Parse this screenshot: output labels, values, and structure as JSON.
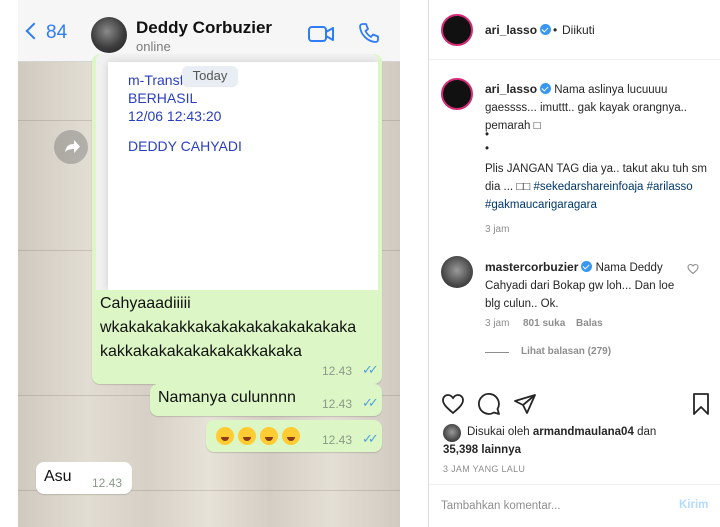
{
  "whatsapp": {
    "back_count": "84",
    "contact_name": "Deddy Corbuzier",
    "contact_status": "online",
    "date_pill": "Today",
    "receipt": {
      "line1": "m-Transfer",
      "line2": "BERHASIL",
      "line3": "12/06 12:43:20",
      "line4": "DEDDY CAHYADI"
    },
    "messages": [
      {
        "text_lines": [
          "Cahyaaadiiiii",
          "wkakakakakkakakakakakakakakaka",
          "kakkakakakakakakakkakaka"
        ],
        "time": "12.43",
        "direction": "out"
      },
      {
        "text": "Namanya culunnnn",
        "time": "12.43",
        "direction": "out"
      },
      {
        "text": "emoji",
        "time": "12.43",
        "direction": "out"
      },
      {
        "text": "Asu",
        "time": "12.43",
        "direction": "in"
      }
    ],
    "icons": {
      "video": "video-camera-icon",
      "phone": "phone-icon",
      "forward": "forward-arrow-icon"
    }
  },
  "instagram": {
    "header": {
      "username": "ari_lasso",
      "separator": "•",
      "follow_status": "Diikuti"
    },
    "caption": {
      "username": "ari_lasso",
      "text_a": "Nama aslinya lucuuuu gaessss... imuttt.. gak kayak orangnya.. pemarah",
      "face_glyph": "□",
      "dot": "•",
      "text_b": "Plis JANGAN TAG dia ya.. takut aku tuh sm dia ...",
      "glyphs": "□□",
      "tags": [
        "#sekedarshareinfoaja",
        "#arilasso",
        "#gakmaucarigaragara"
      ],
      "time": "3 jam"
    },
    "comment": {
      "username": "mastercorbuzier",
      "text": "Nama Deddy Cahyadi dari Bokap gw loh... Dan loe blg culun.. Ok.",
      "time": "3 jam",
      "likes": "801 suka",
      "reply": "Balas",
      "view_replies": "Lihat balasan (279)"
    },
    "likes": {
      "prefix": "Disukai oleh",
      "user": "armandmaulana04",
      "connector": "dan",
      "count": "35,398 lainnya"
    },
    "post_time": "3 JAM YANG LALU",
    "comment_placeholder": "Tambahkan komentar...",
    "post_button": "Kirim",
    "colors": {
      "verified": "#3897f0",
      "tag": "#00376b",
      "post_disabled": "#b3dbff"
    }
  }
}
